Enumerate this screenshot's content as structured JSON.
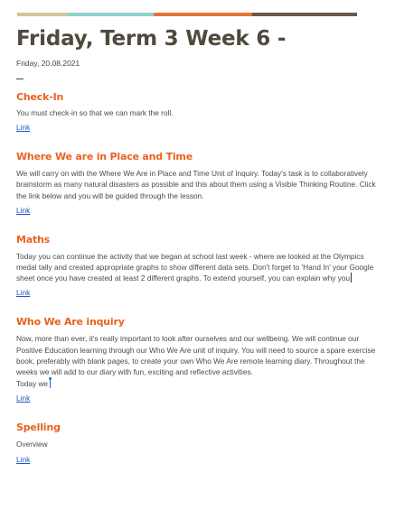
{
  "accent_colors": {
    "bar": [
      "#d4c49a",
      "#8fd3cc",
      "#e8733a",
      "#6b5a47"
    ],
    "heading": "#e8621e",
    "link": "#1a56c8",
    "title": "#4f4a3c"
  },
  "page": {
    "title": "Friday, Term 3 Week 6 -",
    "date": "Friday, 20.08.2021"
  },
  "sections": [
    {
      "heading": "Check-In",
      "paragraphs": [
        "You must check-in so that we can mark the roll."
      ],
      "link": "Link"
    },
    {
      "heading": "Where We are in Place and Time",
      "paragraphs": [
        "We will carry on with the Where We Are in Place and Time Unit of Inquiry. Today's task is to collaboratively brainstorm as many natural disasters as possible and this about them using a Visible Thinking Routine. Click the link below and you will be guided through the lesson."
      ],
      "link": "Link"
    },
    {
      "heading": "Maths",
      "paragraphs": [
        "Today you can continue the activity that we began at school last week - where we looked at the Olympics medal tally and created appropriate graphs to show different data sets. Don't forget to 'Hand In' your Google sheet once you have created at least 2 different graphs. To extend yourself, you can explain why you"
      ],
      "link": "Link"
    },
    {
      "heading": "Who We Are inquiry",
      "paragraphs": [
        "Now, more than ever, it's really important to look after ourselves and our wellbeing. We will continue our Positive Education learning through our Who We Are unit of inquiry. You will need to source a spare exercise book, preferably with blank pages, to create your own Who We Are remote learning diary. Throughout the weeks we will add to our diary with fun, exciting and reflective activities.",
        "Today we"
      ],
      "link": "Link"
    },
    {
      "heading": "Spelling",
      "paragraphs": [
        "Overview"
      ],
      "link": "Link"
    }
  ]
}
